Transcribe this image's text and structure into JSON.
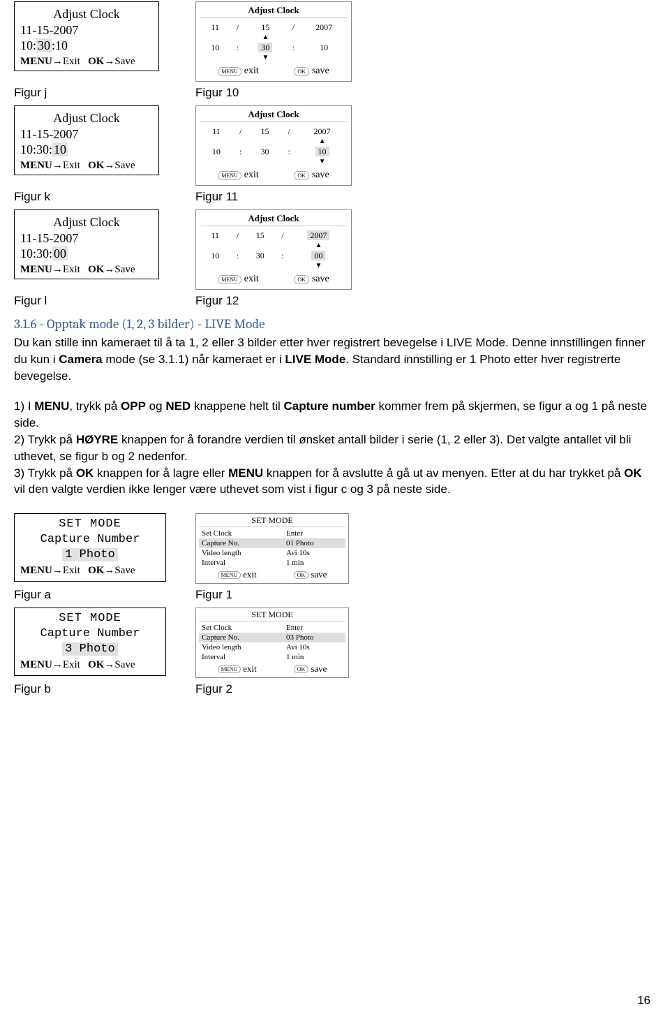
{
  "clock_left": {
    "title": "Adjust Clock",
    "date": "11-15-2007",
    "time_j": "10:30:10",
    "time_j_hl": "30",
    "time_k": "10:30:10",
    "time_k_hl": "10",
    "time_l": "10:30:00",
    "time_l_hl": "00",
    "menu": "MENU",
    "exit": "Exit",
    "ok": "OK",
    "save": "Save",
    "arrow": "→"
  },
  "clock_right": {
    "title": "Adjust Clock",
    "d1": "11",
    "sep1": "/",
    "d2": "15",
    "sep2": "/",
    "d3": "2007",
    "t1": "10",
    "sep3": ":",
    "t2": "30",
    "sep4": ":",
    "t3_a": "10",
    "t3_b": "10",
    "t3_c": "00",
    "menu_btn": "MENU",
    "exit": "exit",
    "ok_btn": "OK",
    "save": "save"
  },
  "captions": {
    "fj": "Figur j",
    "f10": "Figur 10",
    "fk": "Figur k",
    "f11": "Figur 11",
    "fl": "Figur l",
    "f12": "Figur 12",
    "fa": "Figur a",
    "f1": "Figur 1",
    "fb": "Figur b",
    "f2": "Figur 2"
  },
  "heading": "3.1.6 - Opptak mode (1, 2, 3 bilder) - LIVE Mode",
  "para1_a": "Du kan stille inn kameraet til å ta 1, 2 eller 3 bilder etter hver registrert bevegelse i LIVE Mode. Denne innstillingen finner du kun i ",
  "para1_b": "Camera",
  "para1_c": " mode (se 3.1.1) når kameraet er i ",
  "para1_d": "LIVE Mode",
  "para1_e": ". Standard innstilling er 1 Photo etter hver registrerte bevegelse.",
  "step1_a": "1) I ",
  "step1_b": "MENU",
  "step1_c": ", trykk på ",
  "step1_d": "OPP",
  "step1_e": " og ",
  "step1_f": "NED",
  "step1_g": " knappene helt til ",
  "step1_h": "Capture number",
  "step1_i": " kommer frem på skjermen, se figur a og 1 på neste side.",
  "step2_a": "2) Trykk på ",
  "step2_b": "HØYRE",
  "step2_c": " knappen for å forandre verdien til ønsket antall bilder i serie (1, 2 eller 3). Det valgte antallet vil bli uthevet, se figur b og 2 nedenfor.",
  "step3_a": "3) Trykk på ",
  "step3_b": "OK",
  "step3_c": " knappen for å lagre eller ",
  "step3_d": "MENU",
  "step3_e": " knappen for å avslutte å gå ut av menyen. Etter at du har trykket på ",
  "step3_f": "OK",
  "step3_g": " vil den valgte verdien ikke lenger være uthevet som  vist i figur c og 3 på neste side.",
  "setmode_small": {
    "title": "SET MODE",
    "line2": "Capture Number",
    "val_a": "1 Photo",
    "val_b": "3 Photo",
    "menu": "MENU",
    "exit": "Exit",
    "ok": "OK",
    "save": "Save",
    "arrow": "→"
  },
  "setmode_large": {
    "title": "SET MODE",
    "r1a": "Set Clock",
    "r1b": "Enter",
    "r2a": "Capture No.",
    "r2b_1": "01 Photo",
    "r2b_2": "03 Photo",
    "r3a": "Video length",
    "r3b": "Avi 10s",
    "r4a": "Interval",
    "r4b": "1 min",
    "menu_btn": "MENU",
    "exit": "exit",
    "ok_btn": "OK",
    "save": "save"
  },
  "page_number": "16"
}
